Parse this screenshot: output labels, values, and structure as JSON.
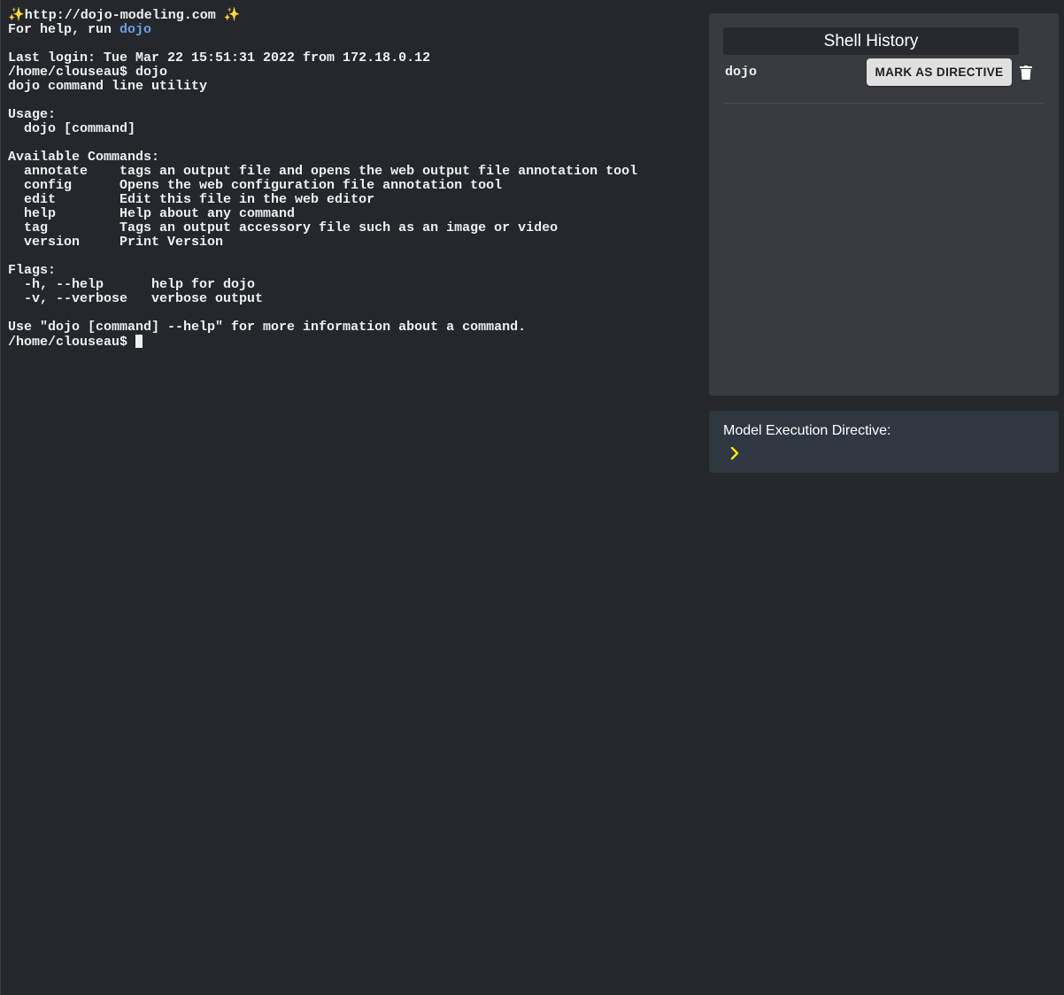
{
  "terminal": {
    "banner_url": "http://dojo-modeling.com",
    "help_prefix": "For help, run ",
    "help_cmd": "dojo",
    "last_login": "Last login: Tue Mar 22 15:51:31 2022 from 172.18.0.12",
    "prompt1": "/home/clouseau$ dojo",
    "lines": [
      "dojo command line utility",
      "",
      "Usage:",
      "  dojo [command]",
      "",
      "Available Commands:",
      "  annotate    tags an output file and opens the web output file annotation tool",
      "  config      Opens the web configuration file annotation tool",
      "  edit        Edit this file in the web editor",
      "  help        Help about any command",
      "  tag         Tags an output accessory file such as an image or video",
      "  version     Print Version",
      "",
      "Flags:",
      "  -h, --help      help for dojo",
      "  -v, --verbose   verbose output",
      "",
      "Use \"dojo [command] --help\" for more information about a command."
    ],
    "prompt2": "/home/clouseau$ "
  },
  "history": {
    "title": "Shell History",
    "items": [
      {
        "command": "dojo",
        "button_label": "MARK AS DIRECTIVE",
        "delete_icon": "trash-icon"
      }
    ]
  },
  "directive": {
    "label": "Model Execution Directive:",
    "prompt_icon": "chevron-right-icon",
    "prompt_color": "#ffea00"
  }
}
